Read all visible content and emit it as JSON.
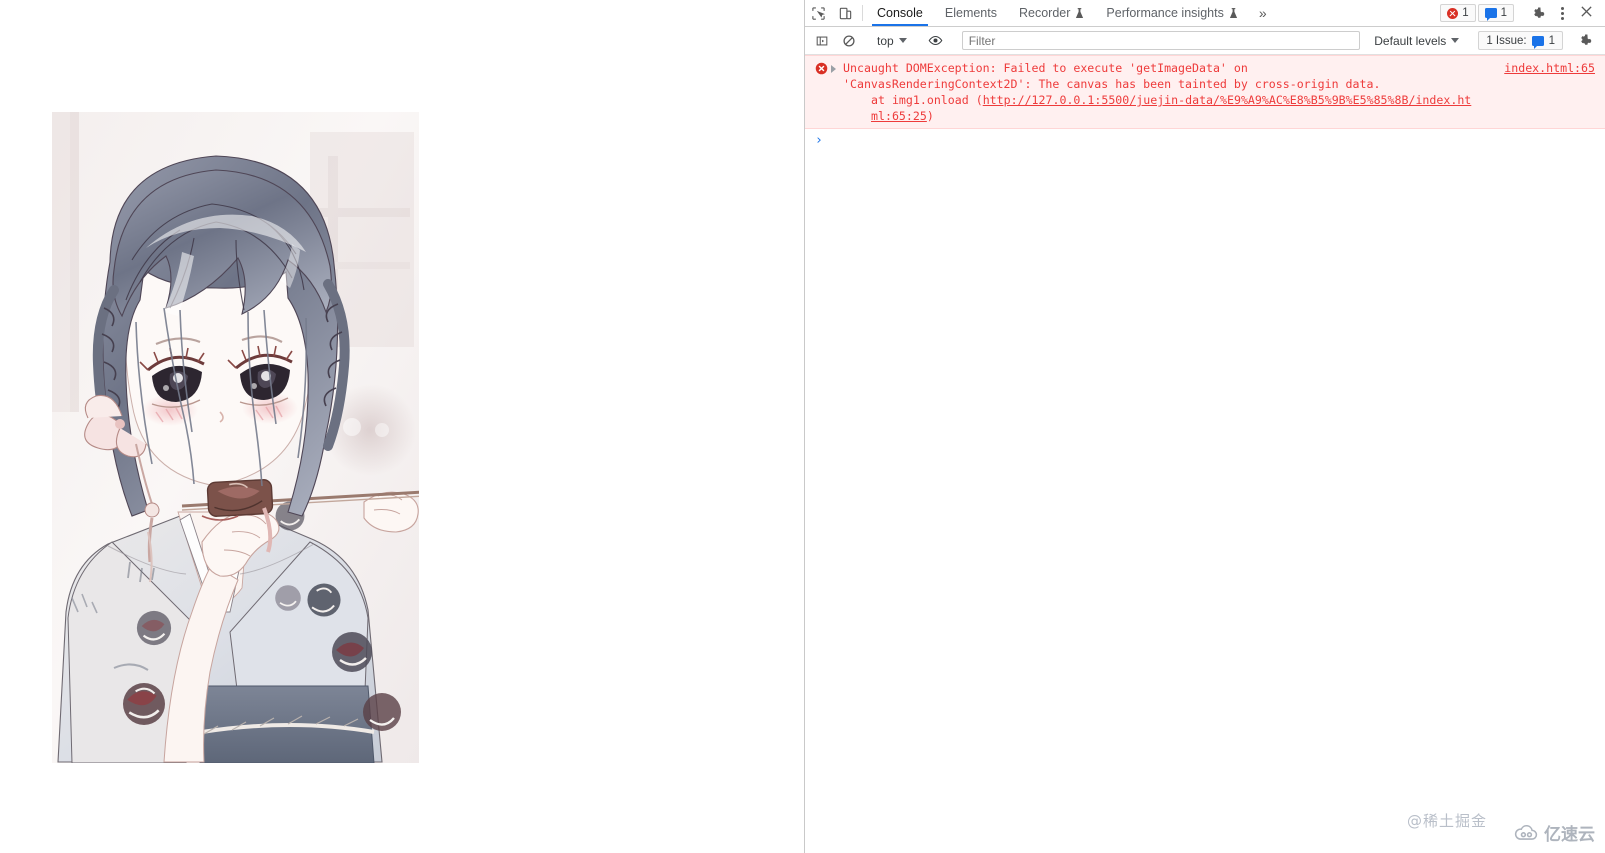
{
  "page": {
    "image_alt": "anime-illustration-girl-kimono"
  },
  "devtools": {
    "toolbar_icons": [
      {
        "name": "inspect-element-icon",
        "label": "Inspect element"
      },
      {
        "name": "device-toolbar-icon",
        "label": "Toggle device toolbar"
      }
    ],
    "tabs": [
      {
        "label": "Console",
        "active": true,
        "experimental": false
      },
      {
        "label": "Elements",
        "active": false,
        "experimental": false
      },
      {
        "label": "Recorder",
        "active": false,
        "experimental": true
      },
      {
        "label": "Performance insights",
        "active": false,
        "experimental": true
      }
    ],
    "more_tabs_label": "»",
    "badges": {
      "error_count": "1",
      "message_count": "1"
    },
    "settings_label": "Settings",
    "menu_label": "Customize and control DevTools",
    "close_label": "Close DevTools"
  },
  "console_toolbar": {
    "sidebar_toggle_label": "Show console sidebar",
    "clear_label": "Clear console",
    "context": "top",
    "eye_label": "Create live expression",
    "filter_placeholder": "Filter",
    "filter_value": "",
    "levels_label": "Default levels",
    "issues_label": "1 Issue:",
    "issues_count": "1",
    "settings_label": "Console settings"
  },
  "console": {
    "messages": [
      {
        "type": "error",
        "icon": "error-circle-icon",
        "expandable": true,
        "line1": "Uncaught DOMException: Failed to execute 'getImageData' on",
        "line2": "'CanvasRenderingContext2D': The canvas has been tainted by cross-origin data.",
        "stack_prefix": "at img1.onload (",
        "stack_url": "http://127.0.0.1:5500/juejin-data/%E9%A9%AC%E8%B5%9B%E5%85%8B/index.html:65:25",
        "stack_suffix": ")",
        "source": "index.html:65"
      }
    ],
    "prompt_symbol": "›",
    "prompt_value": ""
  },
  "watermarks": {
    "primary": "@稀土掘金",
    "secondary": "亿速云"
  },
  "colors": {
    "accent": "#1a73e8",
    "error": "#d93025",
    "error_text": "#ee3b3b",
    "error_bg": "#fff0f0"
  }
}
